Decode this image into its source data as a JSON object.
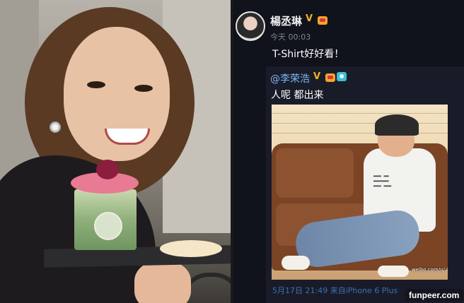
{
  "post": {
    "username": "楊丞琳",
    "verified_mark": "V",
    "timestamp": "今天 00:03",
    "text": "T-Shirt好好看！"
  },
  "repost": {
    "username": "@李荣浩",
    "verified_mark": "V",
    "text": "人呢 都出来",
    "image_watermark": "weibo.com/u/...",
    "footer": "5月17日 21:49 来自iPhone 6 Plus"
  },
  "site_tag": "funpeer.com",
  "colors": {
    "panel_bg": "#10121c",
    "repost_bg": "#191c28",
    "link_blue": "#7eb6f2",
    "verified_gold": "#f2b11f"
  }
}
